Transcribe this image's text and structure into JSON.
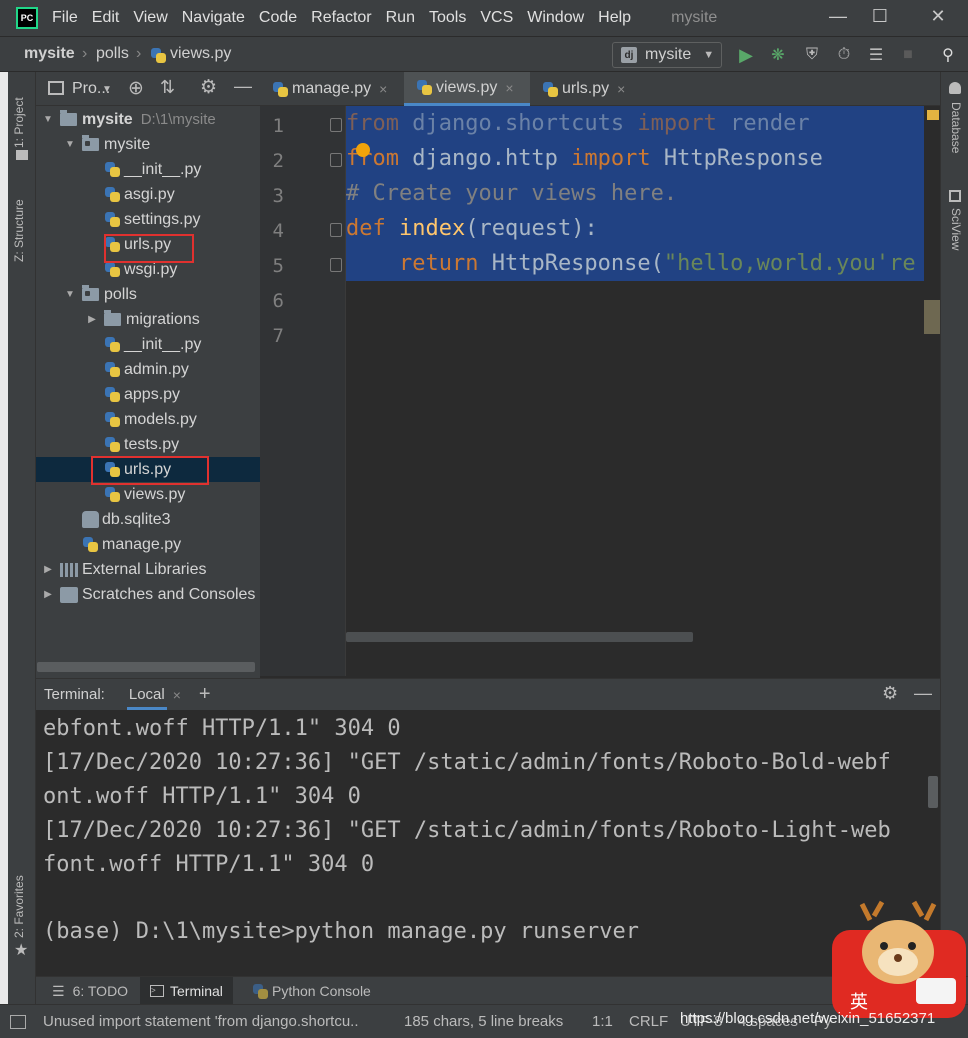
{
  "menubar": {
    "logo_text": "PC",
    "items": [
      "File",
      "Edit",
      "View",
      "Navigate",
      "Code",
      "Refactor",
      "Run",
      "Tools",
      "VCS",
      "Window",
      "Help"
    ],
    "window_title": "mysite"
  },
  "navbar": {
    "breadcrumbs": [
      "mysite",
      "polls",
      "views.py"
    ],
    "run_config": "mysite",
    "run_config_icon": "dj"
  },
  "left_strip": {
    "project_tab": "1: Project",
    "structure_tab": "Z: Structure",
    "favorites_tab": "2: Favorites"
  },
  "right_strip": {
    "database_tab": "Database",
    "sciview_tab": "SciView"
  },
  "project_panel": {
    "title": "Pro...",
    "tree": [
      {
        "label": "mysite",
        "extra": "D:\\1\\mysite",
        "type": "folder",
        "arrow": "▼",
        "level": 0
      },
      {
        "label": "mysite",
        "type": "folder",
        "arrow": "▼",
        "level": 1
      },
      {
        "label": "__init__.py",
        "type": "py",
        "level": 2
      },
      {
        "label": "asgi.py",
        "type": "py",
        "level": 2
      },
      {
        "label": "settings.py",
        "type": "py",
        "level": 2
      },
      {
        "label": "urls.py",
        "type": "py",
        "level": 2
      },
      {
        "label": "wsgi.py",
        "type": "py",
        "level": 2
      },
      {
        "label": "polls",
        "type": "folder",
        "arrow": "▼",
        "level": 1
      },
      {
        "label": "migrations",
        "type": "folder",
        "arrow": "▶",
        "level": 2
      },
      {
        "label": "__init__.py",
        "type": "py",
        "level": 2
      },
      {
        "label": "admin.py",
        "type": "py",
        "level": 2
      },
      {
        "label": "apps.py",
        "type": "py",
        "level": 2
      },
      {
        "label": "models.py",
        "type": "py",
        "level": 2
      },
      {
        "label": "tests.py",
        "type": "py",
        "level": 2
      },
      {
        "label": "urls.py",
        "type": "py",
        "level": 2,
        "selected": true
      },
      {
        "label": "views.py",
        "type": "py",
        "level": 2
      },
      {
        "label": "db.sqlite3",
        "type": "db",
        "level": 1
      },
      {
        "label": "manage.py",
        "type": "py",
        "level": 1
      },
      {
        "label": "External Libraries",
        "type": "lib",
        "arrow": "▶",
        "level": 0
      },
      {
        "label": "Scratches and Consoles",
        "type": "scratch",
        "arrow": "▶",
        "level": 0
      }
    ]
  },
  "editor": {
    "tabs": [
      {
        "label": "manage.py",
        "close": "×"
      },
      {
        "label": "views.py",
        "close": "×",
        "active": true
      },
      {
        "label": "urls.py",
        "close": "×"
      }
    ],
    "line_numbers": [
      "1",
      "2",
      "3",
      "4",
      "5",
      "6",
      "7"
    ],
    "code": {
      "l1": {
        "kw1": "from",
        "mod": " django.shortcuts ",
        "kw2": "import",
        "name": " render"
      },
      "l2": {
        "kw1": "from",
        "mod": " django.http ",
        "kw2": "import",
        "name": " HttpResponse"
      },
      "l3": {
        "comment": "# Create your views here."
      },
      "l4": {
        "kw": "def",
        "sp": " ",
        "fn": "index",
        "rest": "(request):"
      },
      "l5": {
        "indent": "    ",
        "kw": "return",
        "call": " HttpResponse(",
        "str": "\"hello,world.you're"
      }
    }
  },
  "terminal": {
    "label": "Terminal:",
    "tab": "Local",
    "tab_close": "×",
    "add": "+",
    "lines": [
      "ebfont.woff HTTP/1.1\" 304 0",
      "[17/Dec/2020 10:27:36] \"GET /static/admin/fonts/Roboto-Bold-webf",
      "ont.woff HTTP/1.1\" 304 0",
      "[17/Dec/2020 10:27:36] \"GET /static/admin/fonts/Roboto-Light-web",
      "font.woff HTTP/1.1\" 304 0",
      "",
      "(base) D:\\1\\mysite>python manage.py runserver"
    ]
  },
  "bottom_tabs": {
    "todo": "6: TODO",
    "terminal": "Terminal",
    "python_console": "Python Console"
  },
  "statusbar": {
    "message": "Unused import statement 'from django.shortcu..",
    "chars": "185 chars, 5 line breaks",
    "position": "1:1",
    "line_sep": "CRLF",
    "encoding": "UTF-8",
    "indent": "4 spaces",
    "interpreter": "Py"
  },
  "watermark": "https://blog.csdn.net/weixin_51652371",
  "mascot_text": "英",
  "colors": {
    "accent": "#4a88c7",
    "selection": "#214283",
    "highlight_box": "#e0312f",
    "keyword": "#cc7832",
    "function": "#ffc66d",
    "string": "#6a8759",
    "comment": "#808080"
  }
}
